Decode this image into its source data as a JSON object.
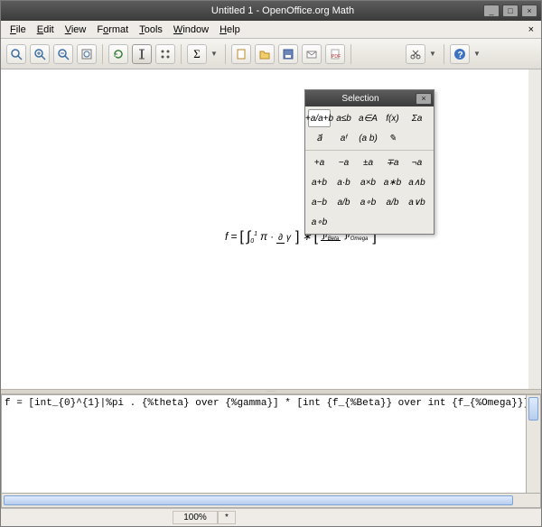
{
  "title": "Untitled 1 - OpenOffice.org Math",
  "window_controls": {
    "min": "_",
    "max": "□",
    "close": "×"
  },
  "menu": {
    "file": "File",
    "edit": "Edit",
    "view": "View",
    "format": "Format",
    "tools": "Tools",
    "window": "Window",
    "help": "Help",
    "doc_close": "×"
  },
  "toolbar_icons": {
    "zoom100": "zoom-100",
    "zoomin": "zoom-in",
    "zoomout": "zoom-out",
    "zoomall": "zoom-all",
    "refresh": "refresh",
    "cursor": "formula-cursor",
    "symbols": "symbols",
    "catalog": "catalog",
    "new": "new",
    "open": "open",
    "save": "save",
    "mail": "mail",
    "pdf": "pdf",
    "print": "print",
    "cut": "cut",
    "help": "help"
  },
  "formula_preview": "f = [ ∫₀¹ π · ∂/γ ] * [ ∫ f_Beta / ∫ f_Omega ]",
  "formula_parts": {
    "lhs": "f",
    "eq": "=",
    "lbr1": "[",
    "int1": "∫",
    "low1": "0",
    "up1": "1",
    "pi": "π",
    "dot": "·",
    "num1": "∂",
    "den1": "γ",
    "rbr1": "]",
    "star": "∗",
    "lbr2": "[",
    "intA": "∫",
    "subA": "f",
    "subAS": "Beta",
    "intB": "∫",
    "subB": "f",
    "subBS": "Omega",
    "rbr2": "]"
  },
  "editor_value": "f = [int_{0}^{1}|%pi . {%theta} over {%gamma}] * [int {f_{%Beta}} over int {f_{%Omega}}]",
  "status": {
    "zoom": "100%",
    "mod": "*"
  },
  "selection_panel": {
    "title": "Selection",
    "close": "×",
    "categories": [
      {
        "id": "unary-binary",
        "label": "+a/a+b",
        "selected": true
      },
      {
        "id": "relations",
        "label": "a≤b"
      },
      {
        "id": "set-ops",
        "label": "a∈A"
      },
      {
        "id": "functions",
        "label": "f(x)"
      },
      {
        "id": "operators",
        "label": "Σa"
      },
      {
        "id": "attributes",
        "label": "a⃗"
      },
      {
        "id": "others",
        "label": "aᶠ"
      },
      {
        "id": "brackets",
        "label": "(a b)"
      },
      {
        "id": "formats",
        "label": "✎"
      }
    ],
    "items": [
      "+a",
      "−a",
      "±a",
      "∓a",
      "¬a",
      "a+b",
      "a·b",
      "a×b",
      "a∗b",
      "a∧b",
      "a−b",
      "a/b",
      "a∘b",
      "a/b",
      "a∨b",
      "a∘b"
    ]
  }
}
